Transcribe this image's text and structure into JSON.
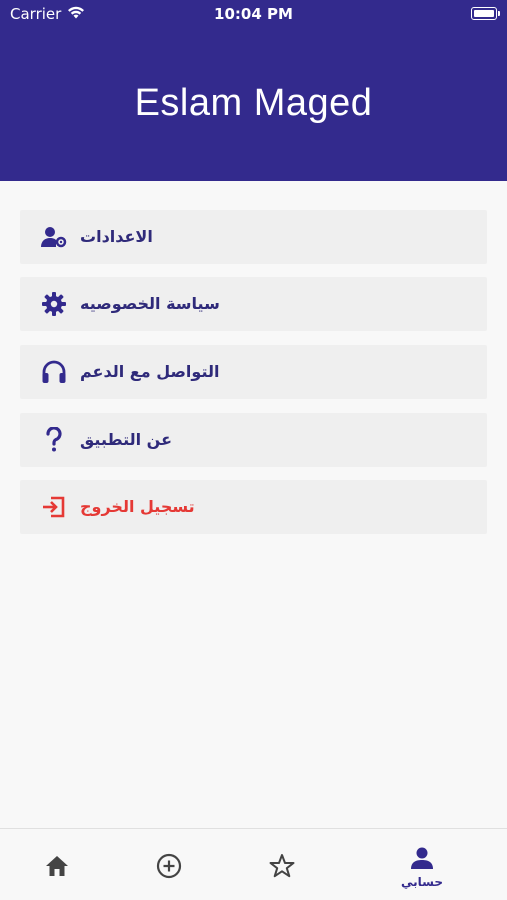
{
  "status_bar": {
    "carrier": "Carrier",
    "time": "10:04 PM"
  },
  "header": {
    "user_name": "Eslam Maged",
    "background": "#332a8d"
  },
  "menu": {
    "items": [
      {
        "label": "الاعدادات",
        "icon": "user-settings-icon"
      },
      {
        "label": "سياسة الخصوصيه",
        "icon": "gear-icon"
      },
      {
        "label": "التواصل مع الدعم",
        "icon": "headphones-icon"
      },
      {
        "label": "عن التطبيق",
        "icon": "question-icon"
      },
      {
        "label": "تسجيل الخروج",
        "icon": "logout-icon",
        "color": "#e53935"
      }
    ]
  },
  "tabbar": {
    "tabs": [
      {
        "label": "",
        "icon": "home-icon"
      },
      {
        "label": "",
        "icon": "add-circle-icon"
      },
      {
        "label": "",
        "icon": "star-icon"
      },
      {
        "label": "حسابي",
        "icon": "user-icon",
        "active": true
      }
    ],
    "accent": "#332a8d"
  }
}
